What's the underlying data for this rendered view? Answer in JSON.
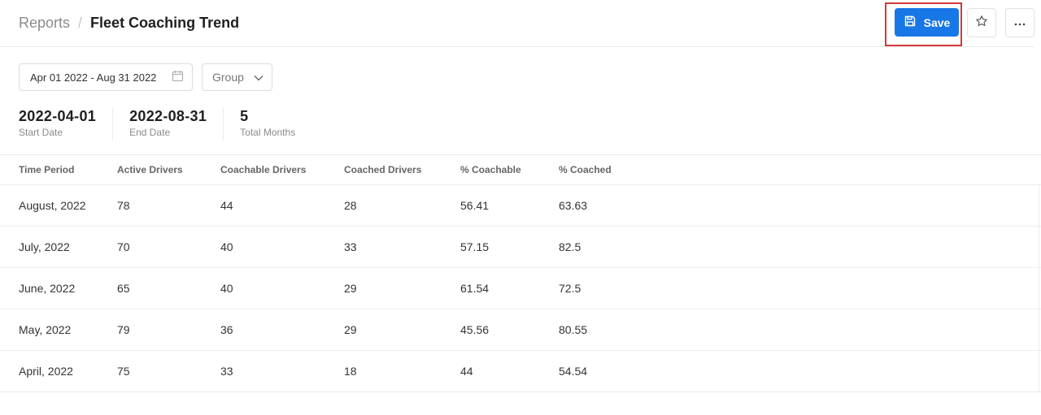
{
  "header": {
    "breadcrumb_parent": "Reports",
    "breadcrumb_sep": "/",
    "title": "Fleet Coaching Trend",
    "save_label": "Save",
    "more_label": "···"
  },
  "filters": {
    "date_range": "Apr 01 2022 - Aug 31 2022",
    "group_placeholder": "Group"
  },
  "stats": [
    {
      "value": "2022-04-01",
      "label": "Start Date"
    },
    {
      "value": "2022-08-31",
      "label": "End Date"
    },
    {
      "value": "5",
      "label": "Total Months"
    }
  ],
  "table": {
    "columns": [
      "Time Period",
      "Active Drivers",
      "Coachable Drivers",
      "Coached Drivers",
      "% Coachable",
      "% Coached"
    ],
    "rows": [
      [
        "August, 2022",
        "78",
        "44",
        "28",
        "56.41",
        "63.63"
      ],
      [
        "July, 2022",
        "70",
        "40",
        "33",
        "57.15",
        "82.5"
      ],
      [
        "June, 2022",
        "65",
        "40",
        "29",
        "61.54",
        "72.5"
      ],
      [
        "May, 2022",
        "79",
        "36",
        "29",
        "45.56",
        "80.55"
      ],
      [
        "April, 2022",
        "75",
        "33",
        "18",
        "44",
        "54.54"
      ]
    ]
  },
  "colors": {
    "accent": "#1877e6",
    "highlight": "#d23a3a"
  },
  "icons": {
    "save": "floppy-disk-icon",
    "star": "star-icon",
    "more": "ellipsis-icon",
    "calendar": "calendar-icon",
    "chevron": "chevron-down-icon"
  }
}
